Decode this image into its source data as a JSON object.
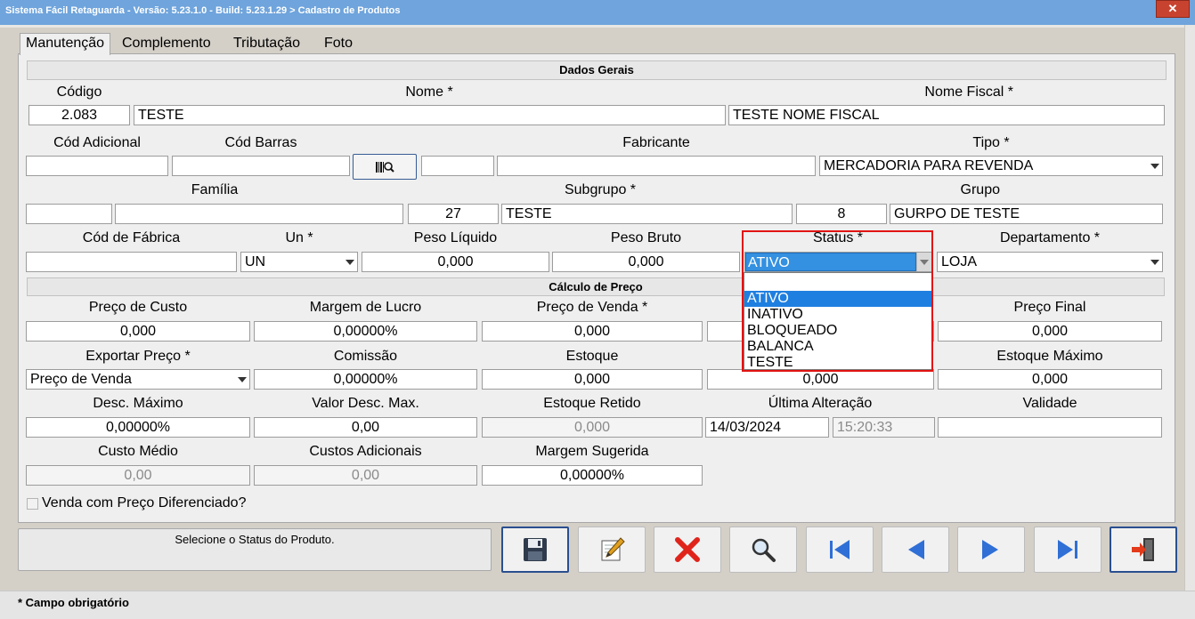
{
  "window": {
    "title": "Sistema Fácil Retaguarda - Versão: 5.23.1.0  - Build: 5.23.1.29 > Cadastro de Produtos",
    "close_glyph": "✕"
  },
  "tabs": [
    {
      "label": "Manutenção",
      "active": true
    },
    {
      "label": "Complemento",
      "active": false
    },
    {
      "label": "Tributação",
      "active": false
    },
    {
      "label": "Foto",
      "active": false
    }
  ],
  "sections": {
    "dados_gerais": "Dados Gerais",
    "calculo_preco": "Cálculo de Preço"
  },
  "labels": {
    "codigo": "Código",
    "nome": "Nome *",
    "nome_fiscal": "Nome Fiscal *",
    "cod_adicional": "Cód Adicional",
    "cod_barras": "Cód Barras",
    "fabricante": "Fabricante",
    "tipo": "Tipo *",
    "familia": "Família",
    "subgrupo": "Subgrupo *",
    "grupo": "Grupo",
    "cod_fabrica": "Cód de Fábrica",
    "un": "Un *",
    "peso_liquido": "Peso Líquido",
    "peso_bruto": "Peso Bruto",
    "status": "Status *",
    "departamento": "Departamento *",
    "preco_custo": "Preço de Custo",
    "margem_lucro": "Margem de Lucro",
    "preco_venda": "Preço de Venda *",
    "preco_final": "Preço Final",
    "exportar_preco": "Exportar Preço *",
    "comissao": "Comissão",
    "estoque": "Estoque",
    "estoque_maximo": "Estoque Máximo",
    "desc_maximo": "Desc. Máximo",
    "valor_desc_max": "Valor Desc. Max.",
    "estoque_retido": "Estoque Retido",
    "ultima_alteracao": "Última Alteração",
    "validade": "Validade",
    "custo_medio": "Custo Médio",
    "custos_adicionais": "Custos Adicionais",
    "margem_sugerida": "Margem Sugerida",
    "venda_diferenciado": "Venda com Preço Diferenciado?"
  },
  "values": {
    "codigo": "2.083",
    "nome": "TESTE",
    "nome_fiscal": "TESTE NOME FISCAL",
    "cod_adicional": "",
    "cod_barras": "",
    "fabricante_cod": "",
    "fabricante": "",
    "tipo": "MERCADORIA PARA REVENDA",
    "familia_cod": "",
    "familia": "",
    "subgrupo_cod": "27",
    "subgrupo": "TESTE",
    "grupo_cod": "8",
    "grupo": "GURPO DE TESTE",
    "cod_fabrica": "",
    "un": "UN",
    "peso_liquido": "0,000",
    "peso_bruto": "0,000",
    "status": "ATIVO",
    "departamento": "LOJA",
    "preco_custo": "0,000",
    "margem_lucro": "0,00000%",
    "preco_venda": "0,000",
    "preco_final": "0,000",
    "exportar_preco": "Preço de Venda",
    "comissao": "0,00000%",
    "estoque": "0,000",
    "estoque_hidden": "0,000",
    "estoque_maximo": "0,000",
    "desc_maximo": "0,00000%",
    "valor_desc_max": "0,00",
    "estoque_retido": "0,000",
    "ultima_alteracao_data": "14/03/2024",
    "ultima_alteracao_hora": "15:20:33",
    "validade": "",
    "custo_medio": "0,00",
    "custos_adicionais": "0,00",
    "margem_sugerida": "0,00000%",
    "venda_diferenciado": false
  },
  "status_options": [
    "ATIVO",
    "INATIVO",
    "BLOQUEADO",
    "BALANCA",
    "TESTE"
  ],
  "status_highlighted": "ATIVO",
  "status_message": "Selecione o Status do Produto.",
  "footer": {
    "required_note": "*  Campo obrigatório"
  },
  "toolbar": [
    {
      "name": "save-button",
      "icon": "floppy-disk-icon"
    },
    {
      "name": "edit-button",
      "icon": "edit-pencil-icon"
    },
    {
      "name": "delete-button",
      "icon": "red-x-icon"
    },
    {
      "name": "search-button",
      "icon": "magnifier-icon"
    },
    {
      "name": "first-record-button",
      "icon": "skip-first-icon"
    },
    {
      "name": "previous-record-button",
      "icon": "arrow-left-icon"
    },
    {
      "name": "next-record-button",
      "icon": "arrow-right-icon"
    },
    {
      "name": "last-record-button",
      "icon": "skip-last-icon"
    },
    {
      "name": "exit-button",
      "icon": "exit-door-icon"
    }
  ],
  "colors": {
    "titlebar": "#6fa4dc",
    "close": "#c8432f",
    "selection": "#1f7fe0",
    "highlight_box": "#e21313",
    "nav_blue": "#2f6fd6"
  }
}
